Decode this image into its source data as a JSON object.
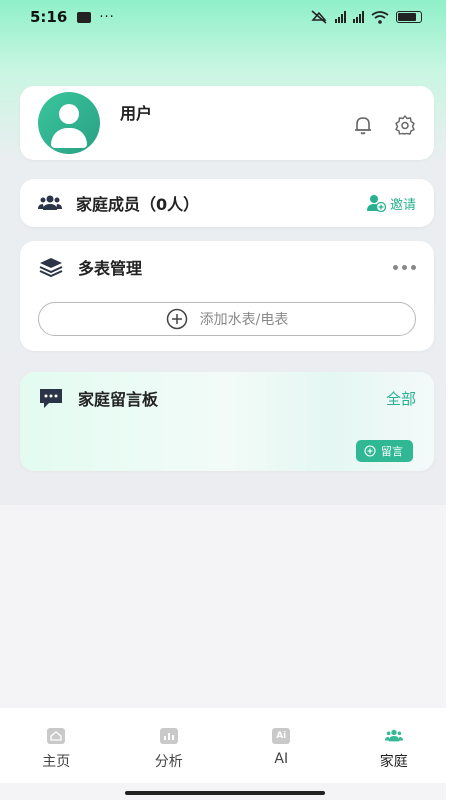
{
  "status": {
    "time": "5:16",
    "dots": "···",
    "battery_level": 0.8
  },
  "profile": {
    "username": "用户"
  },
  "members": {
    "title": "家庭成员（0人）",
    "invite_label": "邀请"
  },
  "meters": {
    "title": "多表管理",
    "add_label": "添加水表/电表"
  },
  "board": {
    "title": "家庭留言板",
    "all_label": "全部",
    "leave_message_label": "留言"
  },
  "tabs": [
    {
      "label": "主页",
      "icon": "home-icon"
    },
    {
      "label": "分析",
      "icon": "chart-icon"
    },
    {
      "label": "AI",
      "icon": "ai-icon",
      "icon_text": "Ai"
    },
    {
      "label": "家庭",
      "icon": "family-icon",
      "active": true
    }
  ],
  "colors": {
    "accent": "#27b18f",
    "button": "#2fb893",
    "header_gradient_top": "#8ff0c9"
  }
}
